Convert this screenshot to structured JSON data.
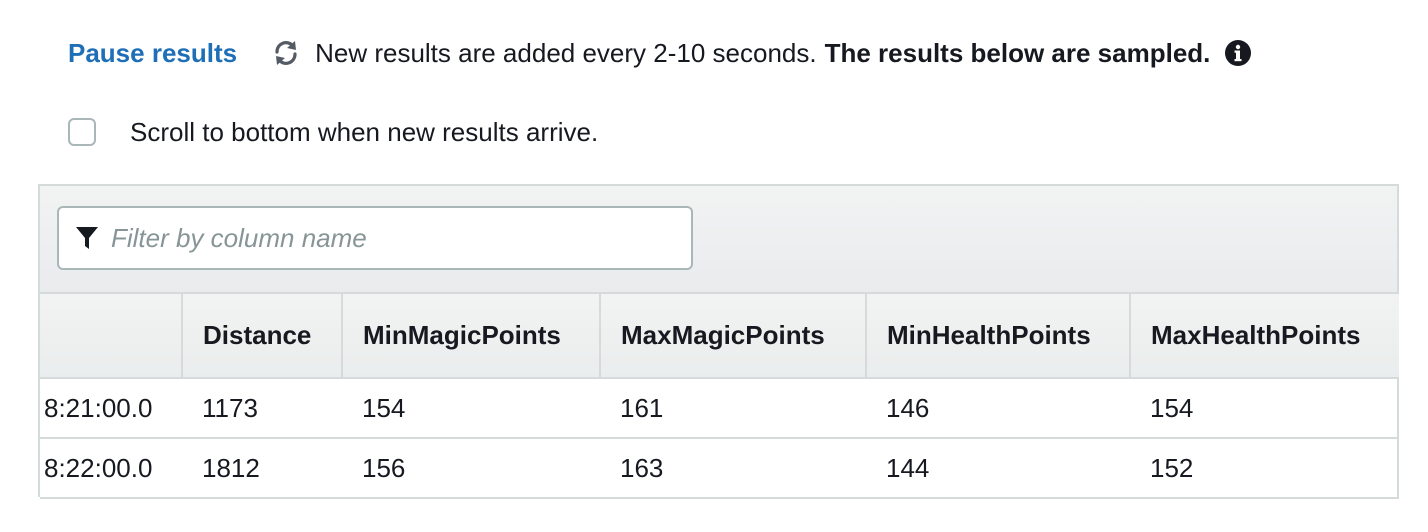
{
  "header": {
    "pause_label": "Pause results",
    "status_text": "New results are added every 2-10 seconds.",
    "status_bold": "The results below are sampled.",
    "refresh_icon": "refresh-icon",
    "info_icon": "info-icon"
  },
  "options": {
    "scroll_label": "Scroll to bottom when new results arrive.",
    "scroll_checked": false
  },
  "filter": {
    "placeholder": "Filter by column name",
    "value": "",
    "icon": "filter-icon"
  },
  "table": {
    "columns": [
      "",
      "Distance",
      "MinMagicPoints",
      "MaxMagicPoints",
      "MinHealthPoints",
      "MaxHealthPoints"
    ],
    "rows": [
      [
        "8:21:00.0",
        "1173",
        "154",
        "161",
        "146",
        "154"
      ],
      [
        "8:22:00.0",
        "1812",
        "156",
        "163",
        "144",
        "152"
      ]
    ]
  },
  "colors": {
    "link": "#1f6fb7",
    "border": "#d5dbdb",
    "text": "#16191f",
    "placeholder": "#879596"
  }
}
